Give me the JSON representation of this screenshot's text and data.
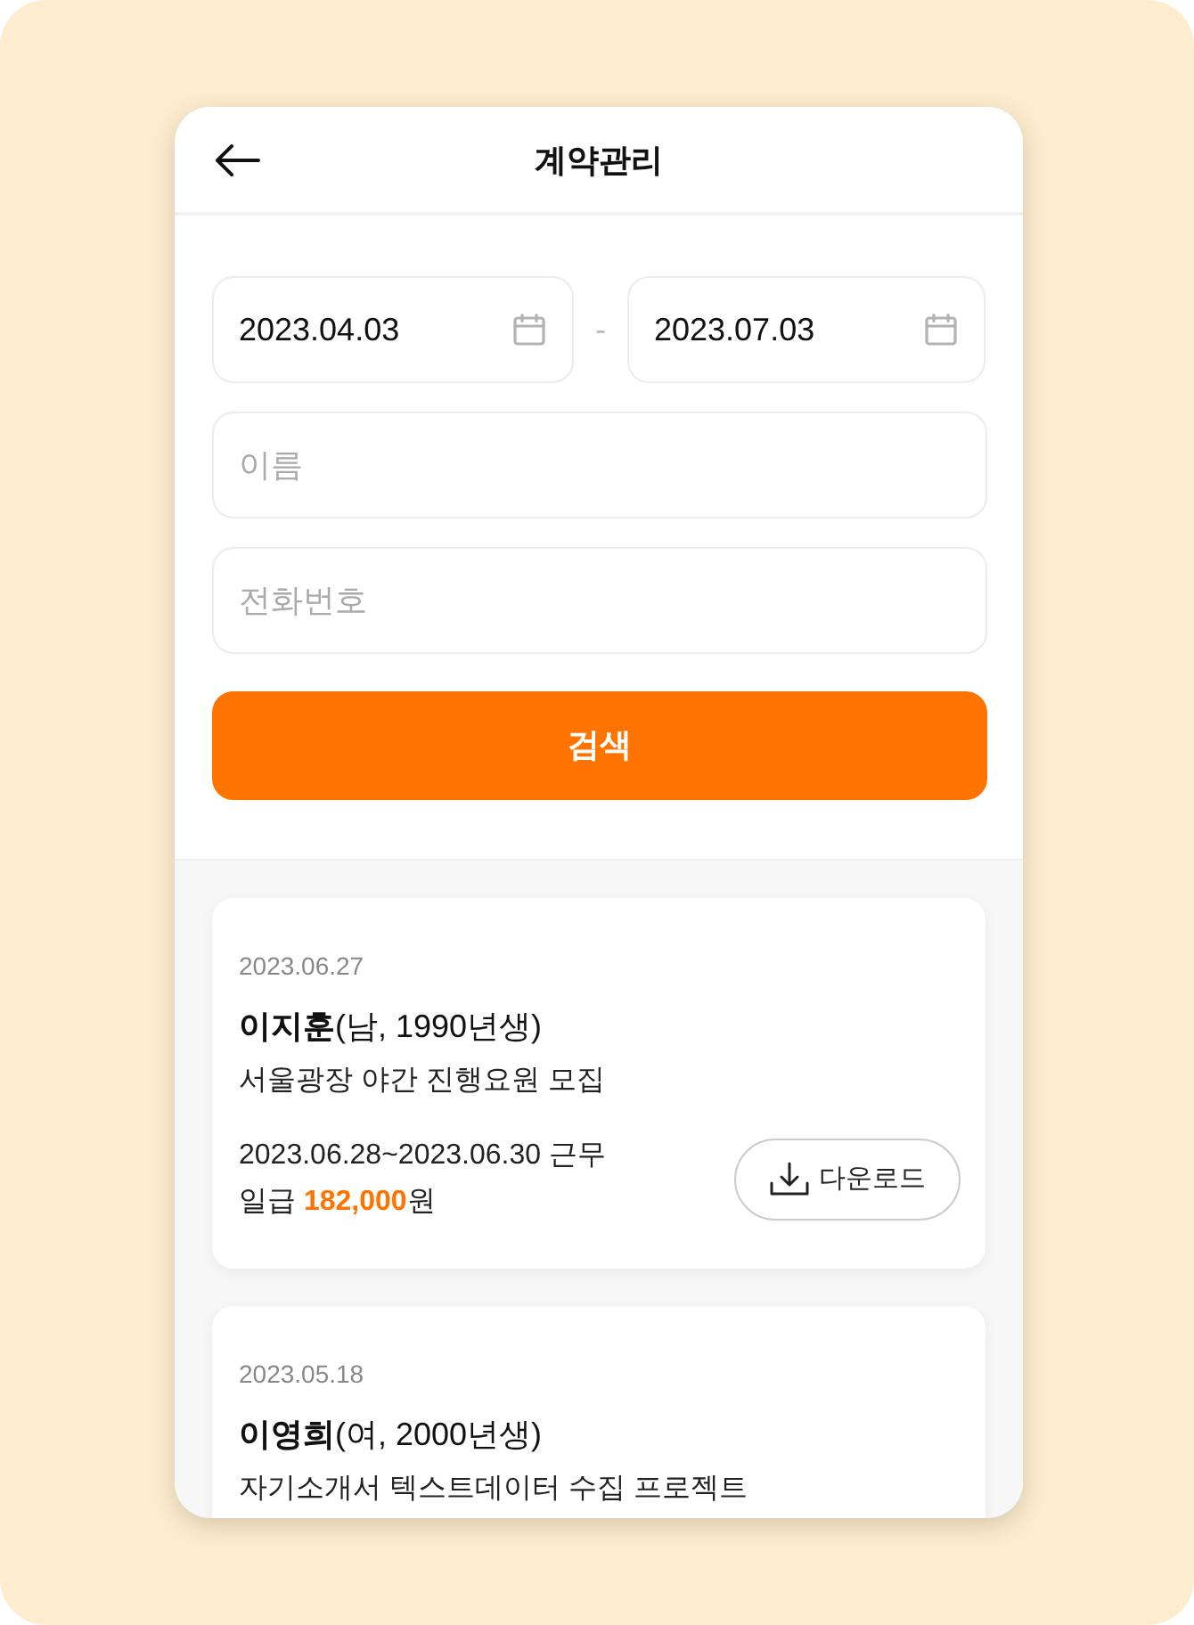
{
  "header": {
    "title": "계약관리"
  },
  "filters": {
    "start_date": "2023.04.03",
    "separator": "-",
    "end_date": "2023.07.03",
    "name_field": {
      "placeholder": "이름"
    },
    "phone_field": {
      "placeholder": "전화번호"
    },
    "search_button": "검색"
  },
  "contracts": [
    {
      "date": "2023.06.27",
      "person": "**이지훈**(남, 1990년생)",
      "job": "서울광장 야간 진행요원 모집",
      "period": "2023.06.28~2023.06.30 근무",
      "wage": "일급 **182,000**원",
      "download_button": "다운로드"
    },
    {
      "date": "2023.05.18",
      "person": "**이영희**(여, 2000년생)",
      "job": "자기소개서 텍스트데이터 수집 프로젝트"
    }
  ]
}
